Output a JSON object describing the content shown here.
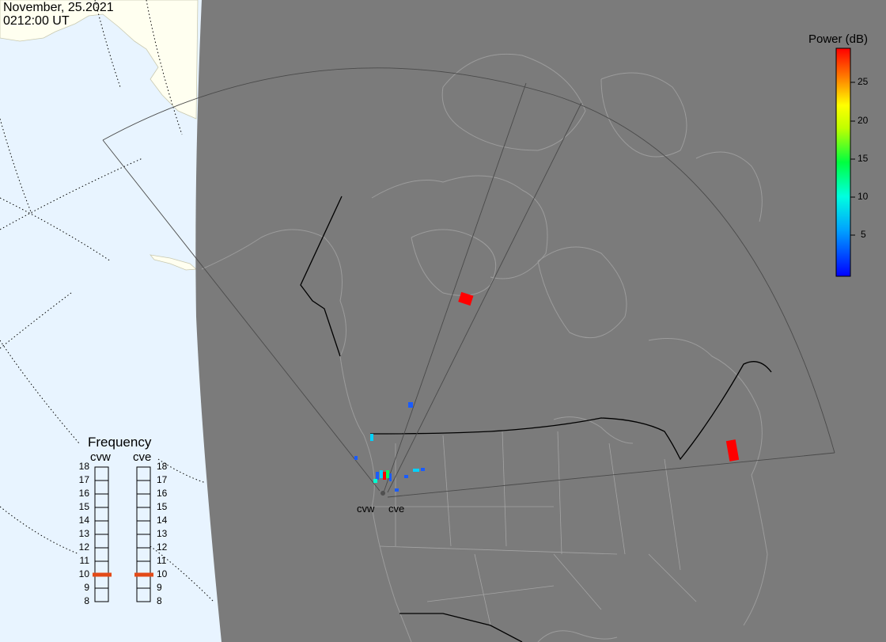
{
  "header": {
    "date": "November, 25.2021",
    "time": "0212:00 UT"
  },
  "colorbar": {
    "title": "Power (dB)",
    "ticks": [
      "25",
      "20",
      "15",
      "10",
      "5"
    ],
    "range": [
      0,
      29
    ]
  },
  "frequency": {
    "title": "Frequency",
    "left_label": "cvw",
    "right_label": "cve",
    "scale": [
      "18",
      "17",
      "16",
      "15",
      "14",
      "13",
      "12",
      "11",
      "10",
      "9",
      "8"
    ],
    "cvw_value": 10.5,
    "cve_value": 10.5
  },
  "radars": [
    {
      "label": "cvw"
    },
    {
      "label": "cve"
    }
  ],
  "colors": {
    "ocean": "#e8f4ff",
    "land_day": "#fffff0",
    "night": "#7b7b7b",
    "coast": "#9c9c9c",
    "border": "#000000",
    "indicator": "#e34a18"
  }
}
